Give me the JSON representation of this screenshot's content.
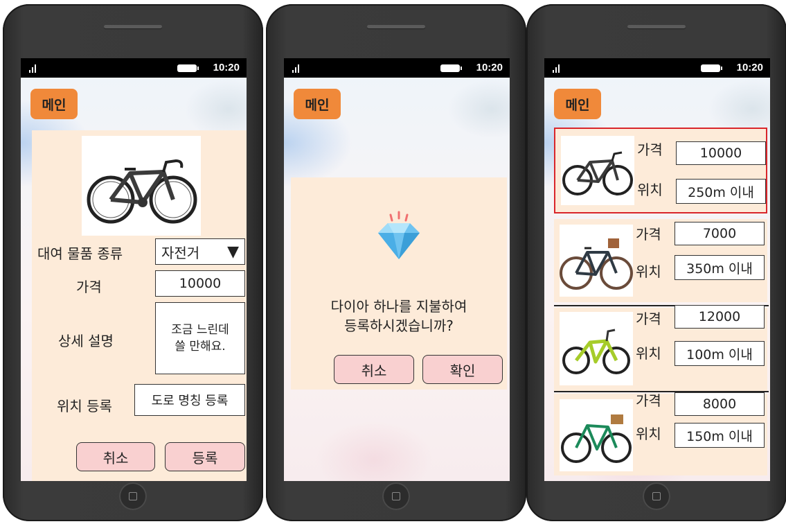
{
  "status": {
    "time": "10:20"
  },
  "common": {
    "main_label": "메인"
  },
  "screen1": {
    "rental_type_label": "대여 물품 종류",
    "rental_type_value": "자전거",
    "dropdown_arrow": "▼",
    "price_label": "가격",
    "price_value": "10000",
    "description_label": "상세 설명",
    "description_line1": "조금 느린데",
    "description_line2": "쓸 만해요.",
    "location_label": "위치 등록",
    "location_button": "도로 명칭 등록",
    "cancel": "취소",
    "register": "등록"
  },
  "screen2": {
    "message_line1": "다이아 하나를 지불하여",
    "message_line2": "등록하시겠습니까?",
    "cancel": "취소",
    "confirm": "확인",
    "icon": "diamond-icon"
  },
  "screen3": {
    "items": [
      {
        "price_label": "가격",
        "price": "10000",
        "location_label": "위치",
        "location": "250m 이내",
        "bike": "road",
        "selected": true
      },
      {
        "price_label": "가격",
        "price": "7000",
        "location_label": "위치",
        "location": "350m 이내",
        "bike": "city-dark",
        "selected": false
      },
      {
        "price_label": "가격",
        "price": "12000",
        "location_label": "위치",
        "location": "100m 이내",
        "bike": "kids-green",
        "selected": false
      },
      {
        "price_label": "가격",
        "price": "8000",
        "location_label": "위치",
        "location": "150m 이내",
        "bike": "city-green",
        "selected": false
      }
    ]
  },
  "colors": {
    "main_button": "#f0893a",
    "panel": "#fdebd9",
    "pink_button": "#f9d0d0",
    "selection_border": "#d9252a"
  }
}
